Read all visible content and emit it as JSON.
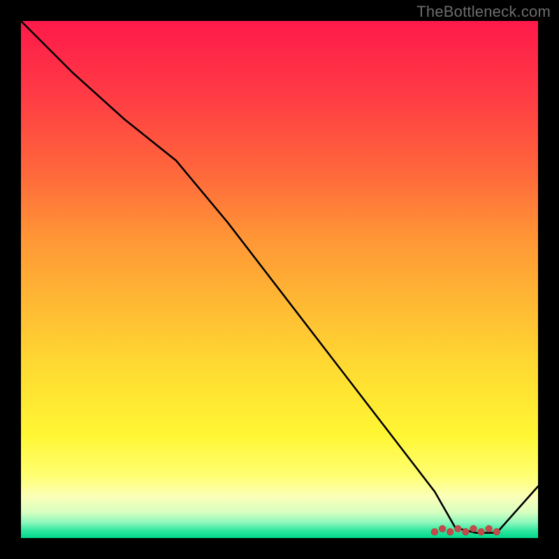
{
  "watermark": "TheBottleneck.com",
  "chart_data": {
    "type": "line",
    "title": "",
    "xlabel": "",
    "ylabel": "",
    "xlim": [
      0,
      100
    ],
    "ylim": [
      0,
      100
    ],
    "grid": false,
    "legend": false,
    "annotations": [],
    "series": [
      {
        "name": "curve",
        "x": [
          0,
          10,
          20,
          30,
          40,
          50,
          60,
          70,
          80,
          84,
          88,
          92,
          100
        ],
        "y": [
          100,
          90,
          81,
          73,
          61,
          48,
          35,
          22,
          9,
          2,
          1,
          1,
          10
        ]
      }
    ],
    "marker_region": {
      "x_start": 80,
      "x_end": 92,
      "y": 1.2
    },
    "colors": {
      "curve": "#000000",
      "markers": "#c34a4a",
      "gradient_top": "#fe1a4a",
      "gradient_bottom": "#00d88a",
      "background": "#000000"
    }
  }
}
